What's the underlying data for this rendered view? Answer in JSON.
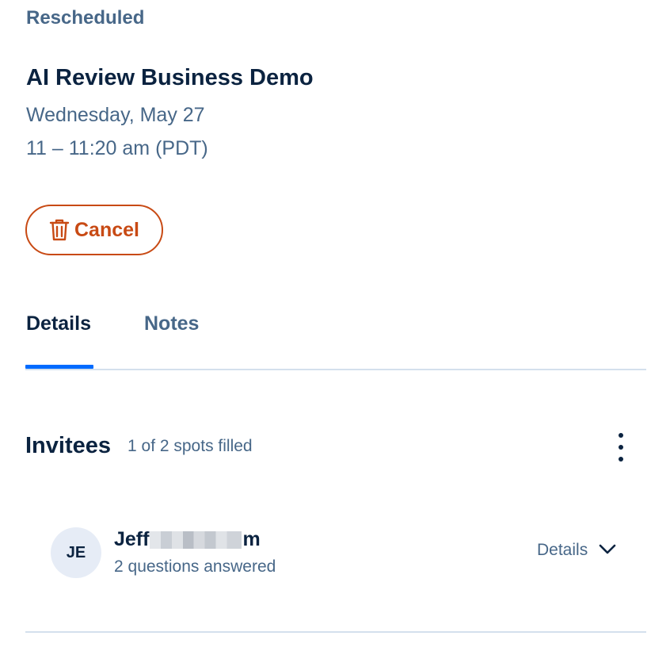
{
  "event": {
    "status": "Rescheduled",
    "title": "AI Review Business Demo",
    "date": "Wednesday, May 27",
    "time": "11 – 11:20 am (PDT)"
  },
  "actions": {
    "cancel_label": "Cancel"
  },
  "tabs": [
    {
      "label": "Details",
      "active": true
    },
    {
      "label": "Notes",
      "active": false
    }
  ],
  "invitees": {
    "heading": "Invitees",
    "spots": "1 of 2 spots filled",
    "items": [
      {
        "initials": "JE",
        "name_prefix": "Jeff",
        "name_suffix": "m",
        "name_redacted": true,
        "questions": "2 questions answered",
        "details_label": "Details"
      }
    ]
  },
  "colors": {
    "accent": "#006bff",
    "danger": "#c84a14",
    "text_primary": "#0b2340",
    "text_secondary": "#476788",
    "divider": "#d4e0ed",
    "avatar_bg": "#e6ecf6"
  }
}
